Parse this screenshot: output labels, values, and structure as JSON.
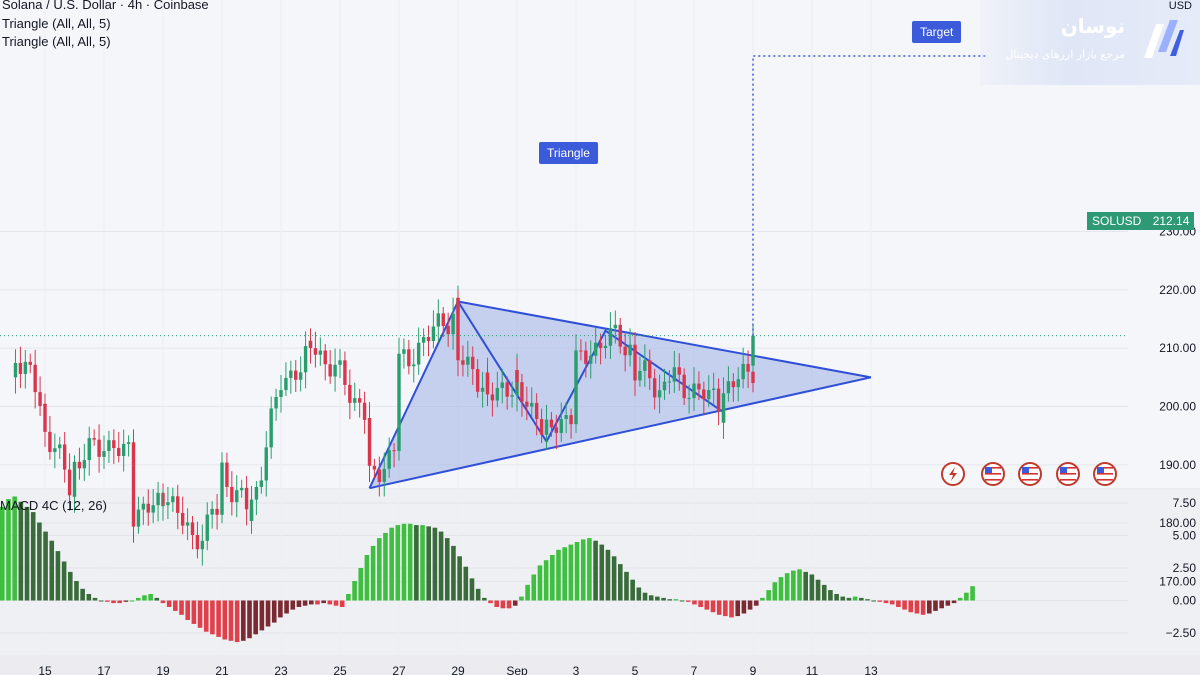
{
  "header": {
    "symbol_line": "Solana / U.S. Dollar · 4h · Coinbase",
    "indicator_1": "Triangle (All, All, 5)",
    "indicator_2": "Triangle (All, All, 5)"
  },
  "brand": {
    "name": "نوسان",
    "tagline": "مرجع بازار ارزهای دیجیتال"
  },
  "annotations": {
    "triangle_label": "Triangle",
    "target_label": "Target"
  },
  "price_scale": {
    "currency": "USD",
    "symbol": "SOLUSD",
    "last_price": "212.14"
  },
  "macd": {
    "title": "MACD 4C (12, 26)"
  },
  "colors": {
    "up": "#2a9d6e",
    "down": "#d9364e",
    "triangle_fill": "#9eb0e6",
    "triangle_line": "#2f4fd8",
    "macd_pos_strong": "#3fbf3f",
    "macd_pos_weak": "#3a6b3a",
    "macd_neg_strong": "#e0404a",
    "macd_neg_weak": "#7a2a30"
  },
  "event_icons": [
    "lightning-icon",
    "us-flag-icon",
    "us-flag-icon",
    "us-flag-icon",
    "us-flag-icon"
  ],
  "chart_data": [
    {
      "type": "candlestick",
      "title": "Solana / U.S. Dollar · 4h · Coinbase",
      "y_ticks": [
        "230.00",
        "220.00",
        "210.00",
        "200.00",
        "190.00",
        "180.00",
        "170.00"
      ],
      "ylim": [
        168,
        243
      ],
      "x_ticks": [
        "15",
        "17",
        "19",
        "21",
        "23",
        "25",
        "27",
        "29",
        "Sep",
        "3",
        "5",
        "7",
        "9",
        "11",
        "13"
      ],
      "last_price": 212.14,
      "close_path": [
        {
          "x": "Aug 14",
          "y": 205
        },
        {
          "x": "Aug 14",
          "y": 209
        },
        {
          "x": "Aug 15",
          "y": 200
        },
        {
          "x": "Aug 15",
          "y": 196
        },
        {
          "x": "Aug 16",
          "y": 185
        },
        {
          "x": "Aug 16",
          "y": 190
        },
        {
          "x": "Aug 17",
          "y": 194
        },
        {
          "x": "Aug 18",
          "y": 191
        },
        {
          "x": "Aug 18",
          "y": 182
        },
        {
          "x": "Aug 19",
          "y": 183
        },
        {
          "x": "Aug 19",
          "y": 186
        },
        {
          "x": "Aug 20",
          "y": 177
        },
        {
          "x": "Aug 21",
          "y": 183
        },
        {
          "x": "Aug 21",
          "y": 189
        },
        {
          "x": "Aug 22",
          "y": 181
        },
        {
          "x": "Aug 22",
          "y": 183
        },
        {
          "x": "Aug 23",
          "y": 204
        },
        {
          "x": "Aug 24",
          "y": 209
        },
        {
          "x": "Aug 24",
          "y": 211
        },
        {
          "x": "Aug 25",
          "y": 205
        },
        {
          "x": "Aug 26",
          "y": 198
        },
        {
          "x": "Aug 26",
          "y": 187
        },
        {
          "x": "Aug 27",
          "y": 194
        },
        {
          "x": "Aug 27",
          "y": 207
        },
        {
          "x": "Aug 28",
          "y": 212
        },
        {
          "x": "Aug 29",
          "y": 217
        },
        {
          "x": "Aug 29",
          "y": 208
        },
        {
          "x": "Aug 30",
          "y": 204
        },
        {
          "x": "Aug 30",
          "y": 201
        },
        {
          "x": "Aug 31",
          "y": 205
        },
        {
          "x": "Aug 31",
          "y": 202
        },
        {
          "x": "Sep 1",
          "y": 197
        },
        {
          "x": "Sep 1",
          "y": 195
        },
        {
          "x": "Sep 2",
          "y": 200
        },
        {
          "x": "Sep 2",
          "y": 207
        },
        {
          "x": "Sep 3",
          "y": 212
        },
        {
          "x": "Sep 4",
          "y": 210
        },
        {
          "x": "Sep 4",
          "y": 206
        },
        {
          "x": "Sep 5",
          "y": 203
        },
        {
          "x": "Sep 5",
          "y": 205
        },
        {
          "x": "Sep 6",
          "y": 203
        },
        {
          "x": "Sep 7",
          "y": 200
        },
        {
          "x": "Sep 7",
          "y": 202
        },
        {
          "x": "Sep 8",
          "y": 207
        },
        {
          "x": "Sep 8",
          "y": 212.14
        }
      ],
      "triangle_pattern": {
        "label": "Triangle",
        "points": [
          {
            "x": "Aug 26",
            "y": 186
          },
          {
            "x": "Aug 29",
            "y": 218
          },
          {
            "x": "Sep 1",
            "y": 194
          },
          {
            "x": "Sep 3",
            "y": 213
          },
          {
            "x": "Sep 7",
            "y": 199
          }
        ],
        "apex": {
          "x": "Sep 12",
          "y": 205
        },
        "target_label": "Target"
      }
    },
    {
      "type": "bar",
      "title": "MACD 4C (12, 26)",
      "y_ticks": [
        "7.50",
        "5.00",
        "2.50",
        "0.00",
        "−2.50"
      ],
      "ylim": [
        -3.8,
        8.4
      ],
      "values": [
        7.2,
        7.8,
        8.0,
        7.6,
        7.2,
        6.8,
        6.0,
        5.3,
        4.6,
        3.8,
        3.0,
        2.2,
        1.5,
        0.9,
        0.5,
        0.2,
        0.0,
        -0.1,
        -0.2,
        -0.2,
        -0.1,
        0.0,
        0.2,
        0.4,
        0.5,
        0.2,
        -0.2,
        -0.5,
        -0.8,
        -1.1,
        -1.5,
        -1.8,
        -2.1,
        -2.4,
        -2.6,
        -2.8,
        -3.0,
        -3.1,
        -3.2,
        -3.1,
        -2.9,
        -2.6,
        -2.3,
        -2.0,
        -1.7,
        -1.3,
        -1.0,
        -0.7,
        -0.5,
        -0.4,
        -0.3,
        -0.3,
        -0.2,
        -0.3,
        -0.4,
        -0.5,
        0.5,
        1.5,
        2.5,
        3.5,
        4.2,
        4.8,
        5.2,
        5.6,
        5.8,
        5.9,
        5.9,
        5.8,
        5.8,
        5.7,
        5.6,
        5.3,
        4.8,
        4.2,
        3.4,
        2.6,
        1.7,
        0.9,
        0.2,
        -0.2,
        -0.5,
        -0.6,
        -0.6,
        -0.4,
        0.3,
        1.2,
        2.0,
        2.7,
        3.1,
        3.5,
        3.9,
        4.1,
        4.3,
        4.5,
        4.7,
        4.8,
        4.6,
        4.3,
        3.9,
        3.4,
        2.8,
        2.2,
        1.6,
        1.0,
        0.6,
        0.4,
        0.3,
        0.2,
        0.1,
        0.1,
        0.0,
        -0.1,
        -0.3,
        -0.5,
        -0.7,
        -0.9,
        -1.1,
        -1.2,
        -1.3,
        -1.2,
        -1.0,
        -0.7,
        -0.4,
        0.2,
        0.8,
        1.4,
        1.8,
        2.1,
        2.3,
        2.4,
        2.2,
        2.0,
        1.6,
        1.2,
        0.8,
        0.5,
        0.3,
        0.2,
        0.3,
        0.2,
        0.1,
        0.0,
        -0.1,
        -0.2,
        -0.3,
        -0.5,
        -0.7,
        -0.9,
        -1.0,
        -1.1,
        -1.0,
        -0.8,
        -0.6,
        -0.4,
        -0.2,
        0.2,
        0.6,
        1.1
      ]
    }
  ]
}
